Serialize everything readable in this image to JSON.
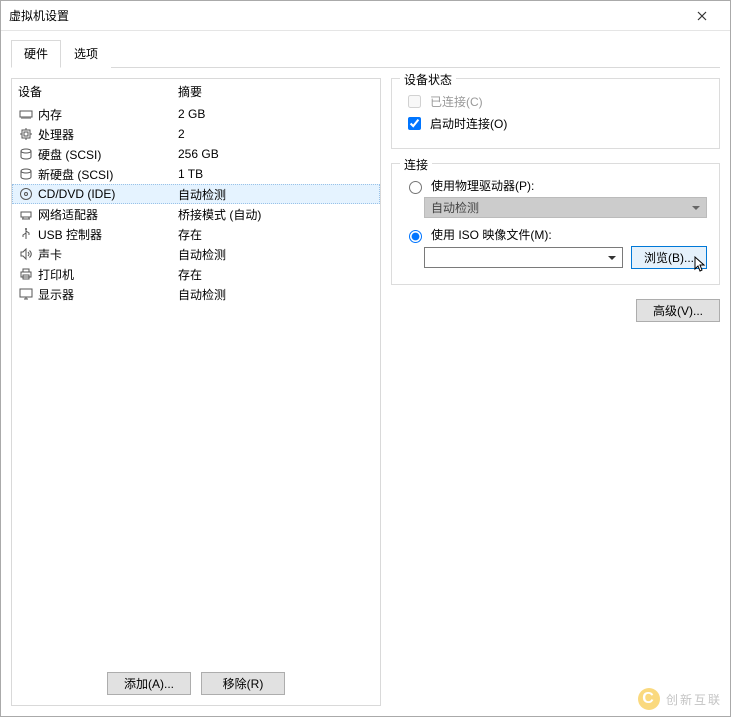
{
  "window": {
    "title": "虚拟机设置"
  },
  "tabs": [
    {
      "label": "硬件",
      "active": true
    },
    {
      "label": "选项",
      "active": false
    }
  ],
  "deviceList": {
    "headers": {
      "device": "设备",
      "summary": "摘要"
    },
    "rows": [
      {
        "icon": "memory-icon",
        "name": "内存",
        "summary": "2 GB"
      },
      {
        "icon": "cpu-icon",
        "name": "处理器",
        "summary": "2"
      },
      {
        "icon": "disk-icon",
        "name": "硬盘 (SCSI)",
        "summary": "256 GB"
      },
      {
        "icon": "disk-icon",
        "name": "新硬盘 (SCSI)",
        "summary": "1 TB"
      },
      {
        "icon": "cd-icon",
        "name": "CD/DVD (IDE)",
        "summary": "自动检测",
        "selected": true
      },
      {
        "icon": "network-icon",
        "name": "网络适配器",
        "summary": "桥接模式 (自动)"
      },
      {
        "icon": "usb-icon",
        "name": "USB 控制器",
        "summary": "存在"
      },
      {
        "icon": "sound-icon",
        "name": "声卡",
        "summary": "自动检测"
      },
      {
        "icon": "printer-icon",
        "name": "打印机",
        "summary": "存在"
      },
      {
        "icon": "display-icon",
        "name": "显示器",
        "summary": "自动检测"
      }
    ]
  },
  "leftButtons": {
    "add": "添加(A)...",
    "remove": "移除(R)"
  },
  "groups": {
    "deviceStatus": {
      "legend": "设备状态",
      "connected": {
        "label": "已连接(C)",
        "checked": false,
        "disabled": true
      },
      "connectOnStart": {
        "label": "启动时连接(O)",
        "checked": true
      }
    },
    "connection": {
      "legend": "连接",
      "usePhysical": {
        "label": "使用物理驱动器(P):",
        "selected": false
      },
      "physicalDropdown": "自动检测",
      "useIso": {
        "label": "使用 ISO 映像文件(M):",
        "selected": true
      },
      "isoPath": "",
      "browse": "浏览(B)..."
    }
  },
  "advanced": "高级(V)...",
  "watermark": "创新互联"
}
